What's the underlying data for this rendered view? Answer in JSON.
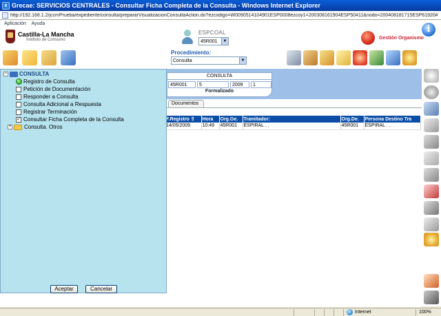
{
  "window": {
    "title": "Grecae: SERVICIOS CENTRALES - Consultar Ficha Completa de la Consulta - Windows Internet Explorer",
    "url": "http://192.168.1.2/jccmPrueba/expediente/consulta/prepararVisualizacionConsultaAction.do?ezcodigo=W009051410490​1ESP0008ezcoy1=200308161904ESP50411&nodo=200408181715ESP61920#"
  },
  "menu": {
    "items": [
      "Aplicación",
      "Ayuda"
    ]
  },
  "header": {
    "org_name": "Castilla-La Mancha",
    "org_sub": "Instituto de Consumo",
    "user_label": "ESPCOAL",
    "user_select": "45R001",
    "procedure_label": "Procedimiento:",
    "procedure_select": "Consulta",
    "gestion_label": "Gestión Organismo"
  },
  "consulta": {
    "header": "CONSULTA",
    "cells": [
      "45R001",
      "5",
      "2009",
      "1"
    ],
    "estado": "Formalizado",
    "tab": "Documentos"
  },
  "table": {
    "columns": [
      "F.Registro",
      "Hora",
      "Org.Ge.",
      "Tramitador:",
      "Org.De.",
      "Persona Destino Tra"
    ],
    "rows": [
      [
        "14/05/2009",
        "10:49",
        "45R001",
        "ESPIRAL . .",
        "45R001",
        "ESPIRAL . ."
      ]
    ]
  },
  "tree": {
    "root": "CONSULTA",
    "items": [
      "Registro de Consulta",
      "Petición de Documentación",
      "Responder a Consulta",
      "Consulta Adicional a Respuesta",
      "Registrar Terminación",
      "Consultar Ficha Completa de la Consulta"
    ],
    "subfolder": "Consulta. Otros",
    "accept": "Aceptar",
    "cancel": "Cancelar"
  },
  "status": {
    "zone": "Internet",
    "zoom": "100%"
  },
  "colors": {
    "title_bar": "#0a4ea8",
    "tree_bg": "#b7e3ef",
    "band": "#9dbfe8",
    "table_header": "#0a4ea8"
  }
}
